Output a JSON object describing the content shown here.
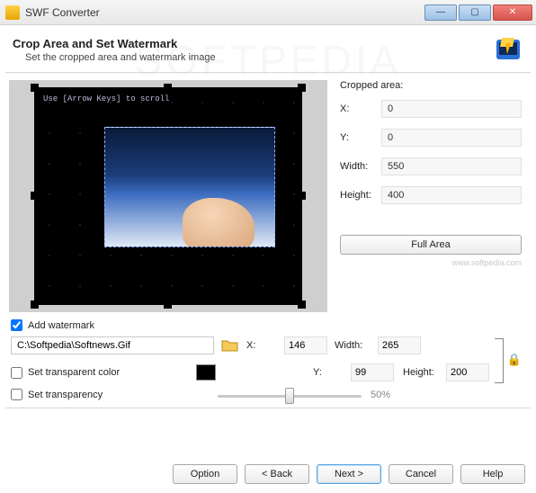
{
  "window": {
    "title": "SWF Converter"
  },
  "header": {
    "title": "Crop Area and Set Watermark",
    "subtitle": "Set the cropped area and watermark image"
  },
  "preview": {
    "hint": "Use [Arrow Keys] to scroll"
  },
  "crop": {
    "group_label": "Cropped area:",
    "x_label": "X:",
    "x": "0",
    "y_label": "Y:",
    "y": "0",
    "w_label": "Width:",
    "w": "550",
    "h_label": "Height:",
    "h": "400",
    "full_area": "Full Area",
    "credit": "www.softpedia.com"
  },
  "watermark_bg": "SOFTPEDIA",
  "wm": {
    "add_label": "Add watermark",
    "add_checked": true,
    "path": "C:\\Softpedia\\Softnews.Gif",
    "x_label": "X:",
    "x": "146",
    "y_label": "Y:",
    "y": "99",
    "w_label": "Width:",
    "w": "265",
    "h_label": "Height:",
    "h": "200",
    "set_color_label": "Set transparent color",
    "set_color_checked": false,
    "color": "#000000",
    "set_trans_label": "Set transparency",
    "set_trans_checked": false,
    "trans_pct": "50%",
    "trans_val": "50"
  },
  "footer": {
    "option": "Option",
    "back": "< Back",
    "next": "Next >",
    "cancel": "Cancel",
    "help": "Help"
  }
}
